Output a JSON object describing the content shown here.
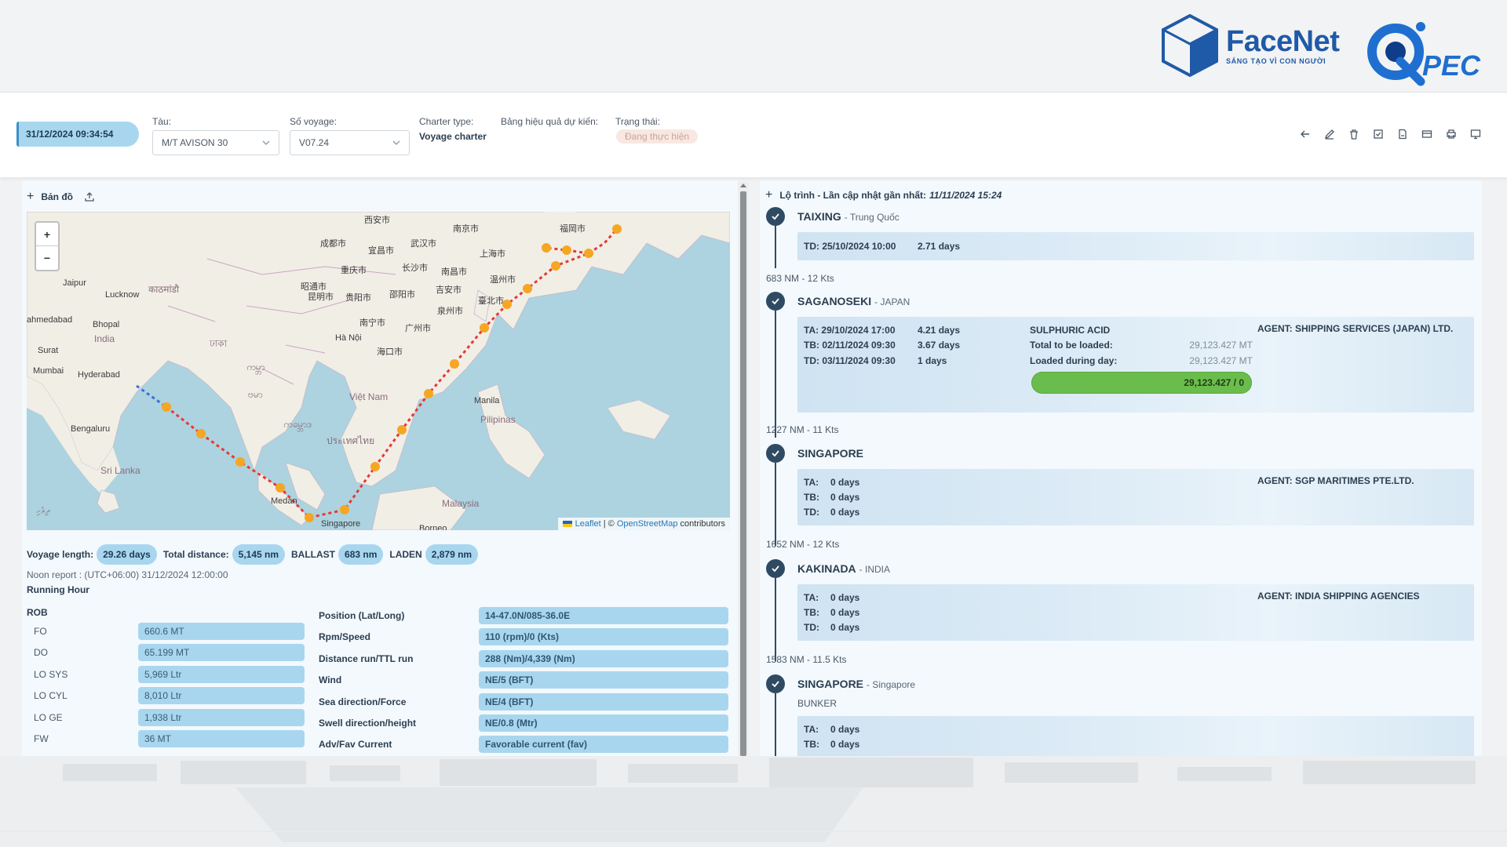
{
  "brand": {
    "facenet_name": "FaceNet",
    "facenet_tagline": "SÁNG TẠO VÌ CON NGƯỜI",
    "qpec_name": "PEC"
  },
  "header": {
    "datetime": "31/12/2024 09:34:54",
    "vessel_label": "Tàu:",
    "vessel_value": "M/T AVISON 30",
    "voyage_label": "Số voyage:",
    "voyage_value": "V07.24",
    "charter_label": "Charter type:",
    "charter_value": "Voyage charter",
    "efficiency_label": "Bảng hiệu quả dự kiến:",
    "status_label": "Trạng thái:",
    "status_value": "Đang thực hiện",
    "toolbar_icons": [
      "back-arrow-icon",
      "edit-icon",
      "delete-icon",
      "check-icon",
      "document-icon",
      "card-icon",
      "print-icon",
      "monitor-icon"
    ]
  },
  "map_panel": {
    "title": "Bản đồ",
    "zoom_in": "+",
    "zoom_out": "−",
    "attribution": {
      "leaflet": "Leaflet",
      "sep": " | © ",
      "osm": "OpenStreetMap",
      "tail": " contributors"
    },
    "cities": [
      "西安市",
      "南京市",
      "福岡市",
      "成都市",
      "武汉市",
      "宜昌市",
      "重庆市",
      "长沙市",
      "南昌市",
      "上海市",
      "温州市",
      "昭通市",
      "贵阳市",
      "邵阳市",
      "吉安市",
      "昆明市",
      "泉州市",
      "臺北市",
      "南宁市",
      "广州市",
      "Hà Nội",
      "海口市",
      "Việt Nam",
      "Manila",
      "Pilipinas",
      "Jaipur",
      "Lucknow",
      "काठमांडौ",
      "Bhopal",
      "India",
      "Surat",
      "Mumbai",
      "Hyderabad",
      "Bengaluru",
      "Sri Lanka",
      "Medan",
      "Singapore",
      "Malaysia",
      "Borneo",
      "ประเทศไทย",
      "ကမ္ဘာ",
      "ဗမာ",
      "ကမ္ဘောဒ",
      "ދިވެހި",
      "ahmedabad",
      "ঢাকা"
    ],
    "countries_colored": {
      "route_laden": "#e53935",
      "route_ballast": "#3f6fd8",
      "waypoint": "#f5a623"
    }
  },
  "voyage_stats": {
    "length_label": "Voyage length:",
    "length_value": "29.26 days",
    "distance_label": "Total distance:",
    "distance_value": "5,145 nm",
    "ballast_label": "BALLAST",
    "ballast_value": "683 nm",
    "laden_label": "LADEN",
    "laden_value": "2,879 nm"
  },
  "noon_report": "Noon report : (UTC+06:00) 31/12/2024 12:00:00",
  "running_hour": "Running Hour",
  "rob": {
    "title": "ROB",
    "rows": [
      {
        "label": "FO",
        "value": "660.6 MT"
      },
      {
        "label": "DO",
        "value": "65.199 MT"
      },
      {
        "label": "LO SYS",
        "value": "5,969 Ltr"
      },
      {
        "label": "LO CYL",
        "value": "8,010 Ltr"
      },
      {
        "label": "LO GE",
        "value": "1,938 Ltr"
      },
      {
        "label": "FW",
        "value": "36 MT"
      }
    ]
  },
  "report": {
    "rows": [
      {
        "label": "Position (Lat/Long)",
        "value": "14-47.0N/085-36.0E"
      },
      {
        "label": "Rpm/Speed",
        "value": "110 (rpm)/0 (Kts)"
      },
      {
        "label": "Distance run/TTL run",
        "value": "288 (Nm)/4,339 (Nm)"
      },
      {
        "label": "Wind",
        "value": "NE/5 (BFT)"
      },
      {
        "label": "Sea direction/Force",
        "value": "NE/4 (BFT)"
      },
      {
        "label": "Swell direction/height",
        "value": "NE/0.8 (Mtr)"
      },
      {
        "label": "Adv/Fav Current",
        "value": "Favorable current (fav)"
      }
    ]
  },
  "route": {
    "title": "Lộ trình - Lần cập nhật gần nhất:",
    "updated": "11/11/2024 15:24",
    "ports": [
      {
        "name": "TAIXING",
        "country": "- Trung Quốc",
        "lines": [
          "TD: 25/10/2024 10:00",
          "2.71 days"
        ]
      },
      {
        "leg": "683 NM - 12 Kts"
      },
      {
        "name": "SAGANOSEKI",
        "country": "- JAPAN",
        "times": [
          {
            "l": "TA: 29/10/2024 17:00",
            "v": "4.21 days"
          },
          {
            "l": "TB: 02/11/2024 09:30",
            "v": "3.67 days"
          },
          {
            "l": "TD: 03/11/2024 09:30",
            "v": "1 days"
          }
        ],
        "cargo": "SULPHURIC ACID",
        "total_label": "Total to be loaded:",
        "total_value": "29,123.427 MT",
        "loaded_label": "Loaded during day:",
        "loaded_value": "29,123.427 MT",
        "progress_label": "29,123.427 / 0",
        "progress_fraction": 1.0,
        "agent": "AGENT: SHIPPING SERVICES (JAPAN) LTD."
      },
      {
        "leg": "1227 NM - 11 Kts"
      },
      {
        "name": "SINGAPORE",
        "country": "",
        "times": [
          {
            "l": "TA:",
            "v": "0 days"
          },
          {
            "l": "TB:",
            "v": "0 days"
          },
          {
            "l": "TD:",
            "v": "0 days"
          }
        ],
        "agent": "AGENT: SGP MARITIMES PTE.LTD."
      },
      {
        "leg": "1652 NM - 12 Kts"
      },
      {
        "name": "KAKINADA",
        "country": "- INDIA",
        "times": [
          {
            "l": "TA:",
            "v": "0 days"
          },
          {
            "l": "TB:",
            "v": "0 days"
          },
          {
            "l": "TD:",
            "v": "0 days"
          }
        ],
        "agent": "AGENT: INDIA SHIPPING AGENCIES"
      },
      {
        "leg": "1583 NM - 11.5 Kts"
      },
      {
        "name": "SINGAPORE",
        "country": "- Singapore",
        "note": "BUNKER",
        "times": [
          {
            "l": "TA:",
            "v": "0 days"
          },
          {
            "l": "TB:",
            "v": "0 days"
          }
        ]
      }
    ]
  }
}
